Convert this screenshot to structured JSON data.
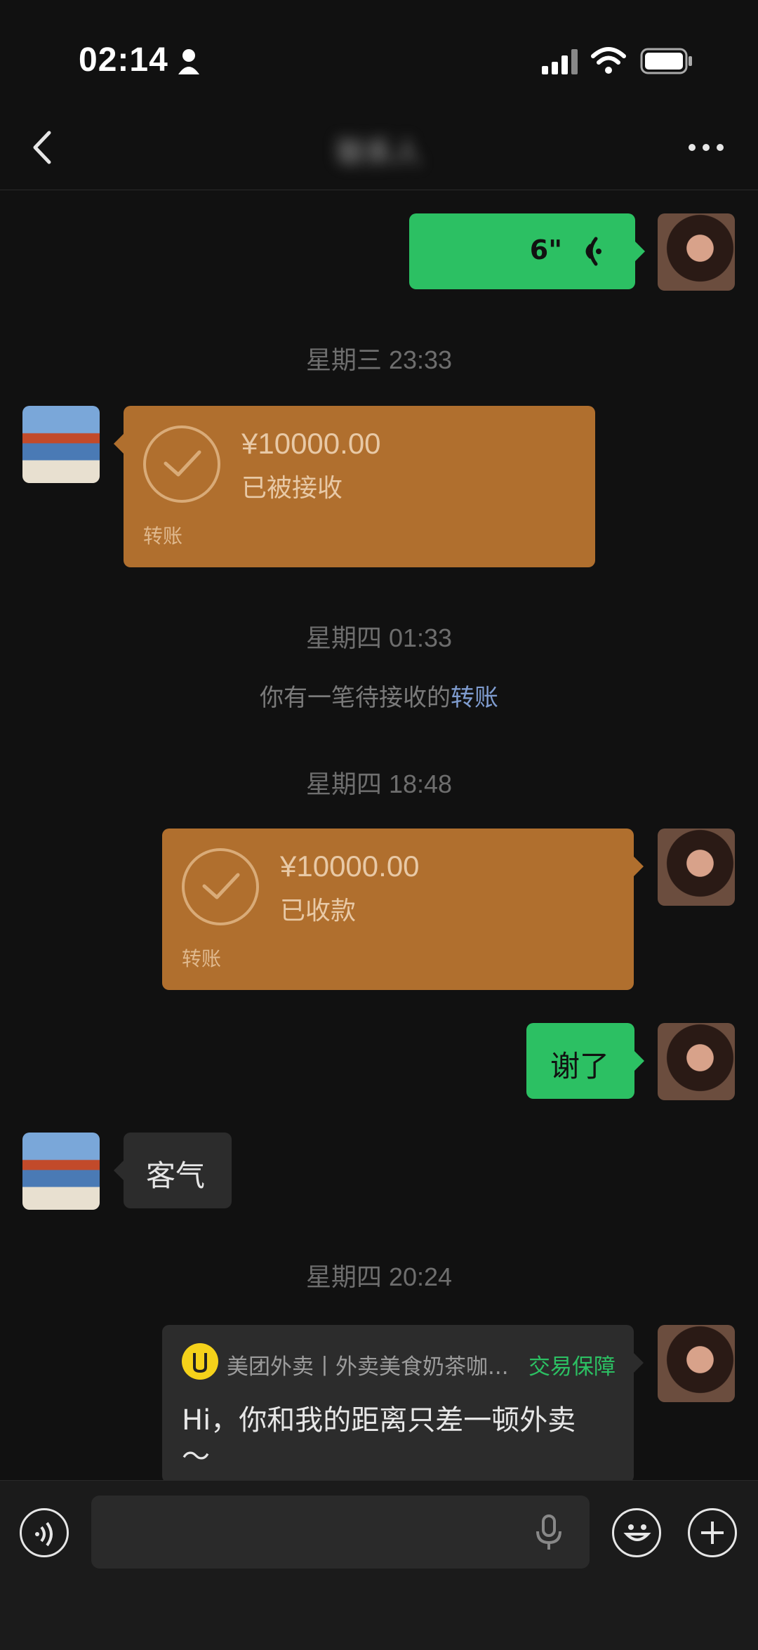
{
  "status_bar": {
    "time": "02:14"
  },
  "nav": {
    "title": "联系人"
  },
  "messages": {
    "voice": {
      "duration": "6\""
    },
    "time1": "星期三 23:33",
    "transfer1": {
      "amount": "¥10000.00",
      "status": "已被接收",
      "label": "转账"
    },
    "time2": "星期四 01:33",
    "system_notice": {
      "text": "你有一笔待接收的",
      "link": "转账"
    },
    "time3": "星期四 18:48",
    "transfer2": {
      "amount": "¥10000.00",
      "status": "已收款",
      "label": "转账"
    },
    "thanks": "谢了",
    "reply": "客气",
    "time4": "星期四 20:24",
    "share_card": {
      "source": "美团外卖丨外卖美食奶茶咖...",
      "badge": "交易保障",
      "title": "Hi，你和我的距离只差一顿外卖～"
    }
  },
  "colors": {
    "green": "#2cc063",
    "transfer": "#b06f2e",
    "link": "#7f9ccf"
  }
}
